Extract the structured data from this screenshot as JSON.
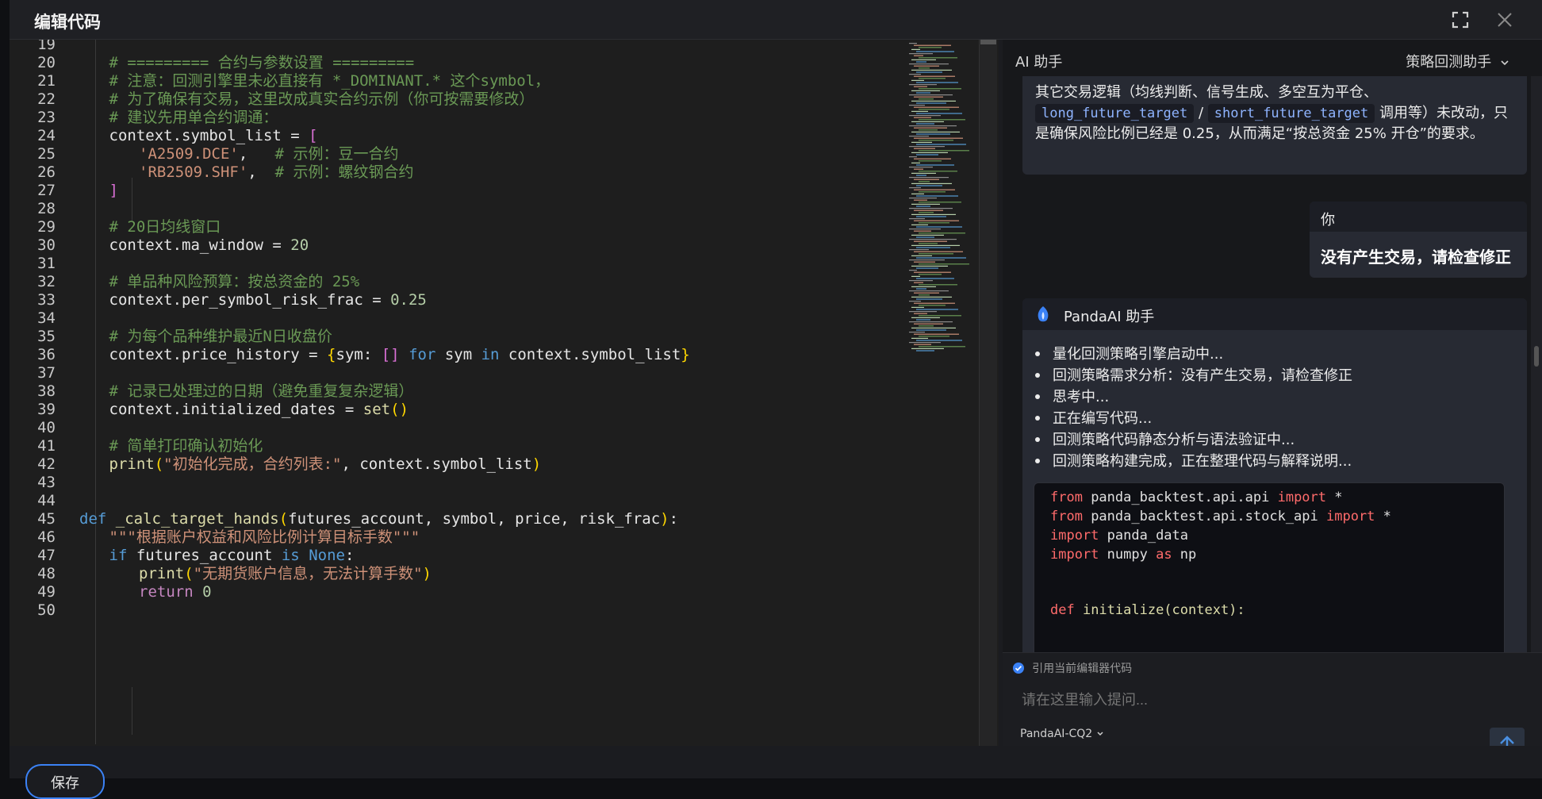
{
  "modal": {
    "title": "编辑代码"
  },
  "icons": {
    "fullscreen": "fullscreen-icon",
    "close": "close-icon"
  },
  "editor": {
    "lines": [
      {
        "n": "19",
        "t": ""
      },
      {
        "n": "20",
        "t": "# ========= 合约与参数设置 ========="
      },
      {
        "n": "21",
        "t": "# 注意：回测引擎里未必直接有 *_DOMINANT.* 这个symbol，"
      },
      {
        "n": "22",
        "t": "# 为了确保有交易，这里改成真实合约示例（你可按需要修改）"
      },
      {
        "n": "23",
        "t": "# 建议先用单合约调通："
      },
      {
        "n": "24",
        "t": "context.symbol_list = ["
      },
      {
        "n": "25",
        "t": "'A2509.DCE',   # 示例：豆一合约"
      },
      {
        "n": "26",
        "t": "'RB2509.SHF',  # 示例：螺纹钢合约"
      },
      {
        "n": "27",
        "t": "]"
      },
      {
        "n": "28",
        "t": ""
      },
      {
        "n": "29",
        "t": "# 20日均线窗口"
      },
      {
        "n": "30",
        "t": "context.ma_window = 20"
      },
      {
        "n": "31",
        "t": ""
      },
      {
        "n": "32",
        "t": "# 单品种风险预算：按总资金的 25%"
      },
      {
        "n": "33",
        "t": "context.per_symbol_risk_frac = 0.25"
      },
      {
        "n": "34",
        "t": ""
      },
      {
        "n": "35",
        "t": "# 为每个品种维护最近N日收盘价"
      },
      {
        "n": "36",
        "t": "context.price_history = {sym: [] for sym in context.symbol_list}"
      },
      {
        "n": "37",
        "t": ""
      },
      {
        "n": "38",
        "t": "# 记录已处理过的日期（避免重复复杂逻辑）"
      },
      {
        "n": "39",
        "t": "context.initialized_dates = set()"
      },
      {
        "n": "40",
        "t": ""
      },
      {
        "n": "41",
        "t": "# 简单打印确认初始化"
      },
      {
        "n": "42",
        "t": "print(\"初始化完成，合约列表:\", context.symbol_list)"
      },
      {
        "n": "43",
        "t": ""
      },
      {
        "n": "44",
        "t": ""
      },
      {
        "n": "45",
        "t": "def _calc_target_hands(futures_account, symbol, price, risk_frac):"
      },
      {
        "n": "46",
        "t": "\"\"\"根据账户权益和风险比例计算目标手数\"\"\""
      },
      {
        "n": "47",
        "t": "if futures_account is None:"
      },
      {
        "n": "48",
        "t": "print(\"无期货账户信息，无法计算手数\")"
      },
      {
        "n": "49",
        "t": "return 0"
      },
      {
        "n": "50",
        "t": ""
      }
    ]
  },
  "panel": {
    "title": "AI 助手",
    "mode": "策略回测助手",
    "msg1": {
      "text_a": "其它交易逻辑（均线判断、信号生成、多空互为平仓、",
      "chip1": "long_future_target",
      "sep": "/",
      "chip2": "short_future_target",
      "text_b": "调用等）未改动，只",
      "text_c": "是确保风险比例已经是 0.25，从而满足“按总资金 25% 开仓”的要求。"
    },
    "user_msg": {
      "who": "你",
      "text": "没有产生交易，请检查修正"
    },
    "assistant": {
      "name": "PandaAI 助手",
      "steps": [
        "量化回测策略引擎启动中...",
        "回测策略需求分析：没有产生交易，请检查修正",
        "思考中...",
        "正在编写代码...",
        "回测策略代码静态分析与语法验证中...",
        "回测策略构建完成，正在整理代码与解释说明..."
      ],
      "code": [
        {
          "a": "from ",
          "b": "panda_backtest.api.api ",
          "c": "import",
          "d": " *"
        },
        {
          "a": "from ",
          "b": "panda_backtest.api.stock_api ",
          "c": "import",
          "d": " *"
        },
        {
          "a": "import ",
          "b": "panda_data",
          "c": "",
          "d": ""
        },
        {
          "a": "import ",
          "b": "numpy ",
          "c": "as",
          "d": " np"
        },
        {
          "a": "",
          "b": "",
          "c": "",
          "d": ""
        },
        {
          "a": "",
          "b": "",
          "c": "",
          "d": ""
        },
        {
          "a": "def ",
          "b": "initialize(context):",
          "c": "",
          "d": ""
        }
      ]
    },
    "ref_label": "引用当前编辑器代码",
    "input_placeholder": "请在这里输入提问...",
    "model": "PandaAI-CQ2"
  },
  "footer": {
    "button_label": "保存"
  }
}
